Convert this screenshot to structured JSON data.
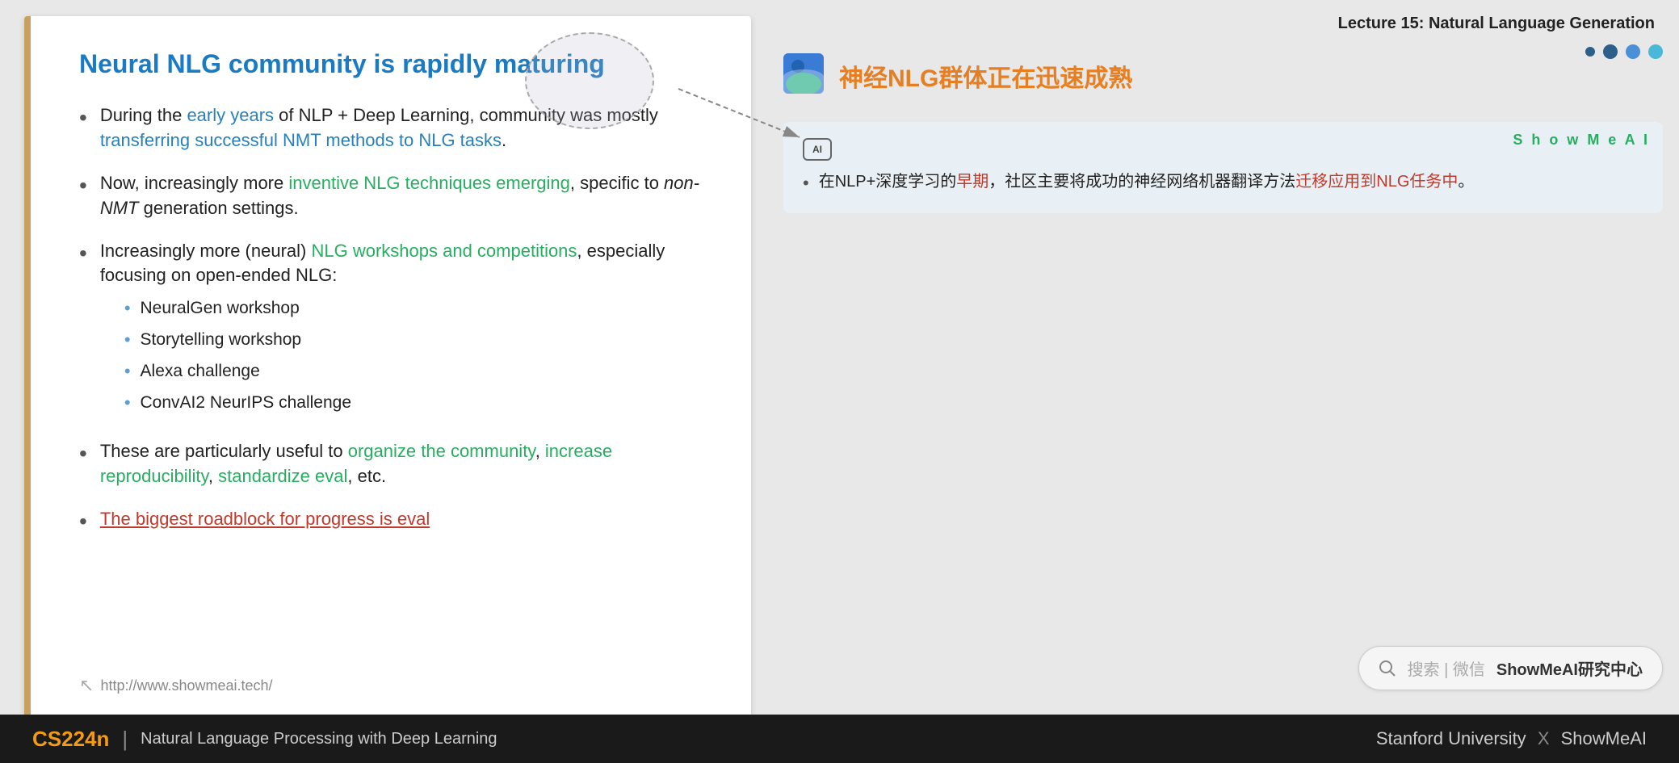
{
  "header": {
    "lecture_title": "Lecture 15: Natural Language Generation"
  },
  "slide": {
    "title": "Neural NLG community is rapidly maturing",
    "bullets": [
      {
        "text_parts": [
          {
            "text": "During the ",
            "style": "normal"
          },
          {
            "text": "early years",
            "style": "blue-link"
          },
          {
            "text": " of NLP + Deep Learning, community was mostly ",
            "style": "normal"
          },
          {
            "text": "transferring successful NMT methods to NLG tasks",
            "style": "blue-link"
          },
          {
            "text": ".",
            "style": "normal"
          }
        ]
      },
      {
        "text_parts": [
          {
            "text": "Now, increasingly more ",
            "style": "normal"
          },
          {
            "text": "inventive NLG techniques emerging",
            "style": "green"
          },
          {
            "text": ", specific to ",
            "style": "normal"
          },
          {
            "text": "non-NMT",
            "style": "italic"
          },
          {
            "text": " generation settings.",
            "style": "normal"
          }
        ]
      },
      {
        "text_parts": [
          {
            "text": "Increasingly more (neural) ",
            "style": "normal"
          },
          {
            "text": "NLG workshops and competitions",
            "style": "green"
          },
          {
            "text": ", especially focusing on open-ended NLG:",
            "style": "normal"
          }
        ],
        "sub_bullets": [
          "NeuralGen workshop",
          "Storytelling workshop",
          "Alexa challenge",
          "ConvAI2 NeurIPS challenge"
        ]
      },
      {
        "text_parts": [
          {
            "text": "These are particularly useful to ",
            "style": "normal"
          },
          {
            "text": "organize the community",
            "style": "green"
          },
          {
            "text": ", ",
            "style": "normal"
          },
          {
            "text": "increase reproducibility",
            "style": "green"
          },
          {
            "text": ", ",
            "style": "normal"
          },
          {
            "text": "standardize eval",
            "style": "green"
          },
          {
            "text": ", etc.",
            "style": "normal"
          }
        ]
      },
      {
        "text_parts": [
          {
            "text": "The biggest roadblock for progress is eval",
            "style": "red-underline"
          }
        ],
        "red_bullet": true
      }
    ],
    "url": "http://www.showmeai.tech/"
  },
  "right_panel": {
    "chinese_title": "神经NLG群体正在迅速成熟",
    "nav_dots": [
      "filled",
      "active",
      "outline"
    ],
    "showmeai_label": "ShowMeAI",
    "ai_icon_label": "AI",
    "translation": {
      "bullet": "在NLP+深度学习的早期，社区主要将成功的神经网络机器翻译方法迁移应用到NLG任务中。",
      "early_text": "早期",
      "transfer_text": "迁移应用到NLG任务中"
    },
    "search_bar": "搜索 | 微信 ShowMeAI研究中心"
  },
  "footer": {
    "course_code": "CS224n",
    "separator": "|",
    "course_desc": "Natural Language Processing with Deep Learning",
    "university": "Stanford University",
    "x": "X",
    "brand": "ShowMeAI"
  }
}
